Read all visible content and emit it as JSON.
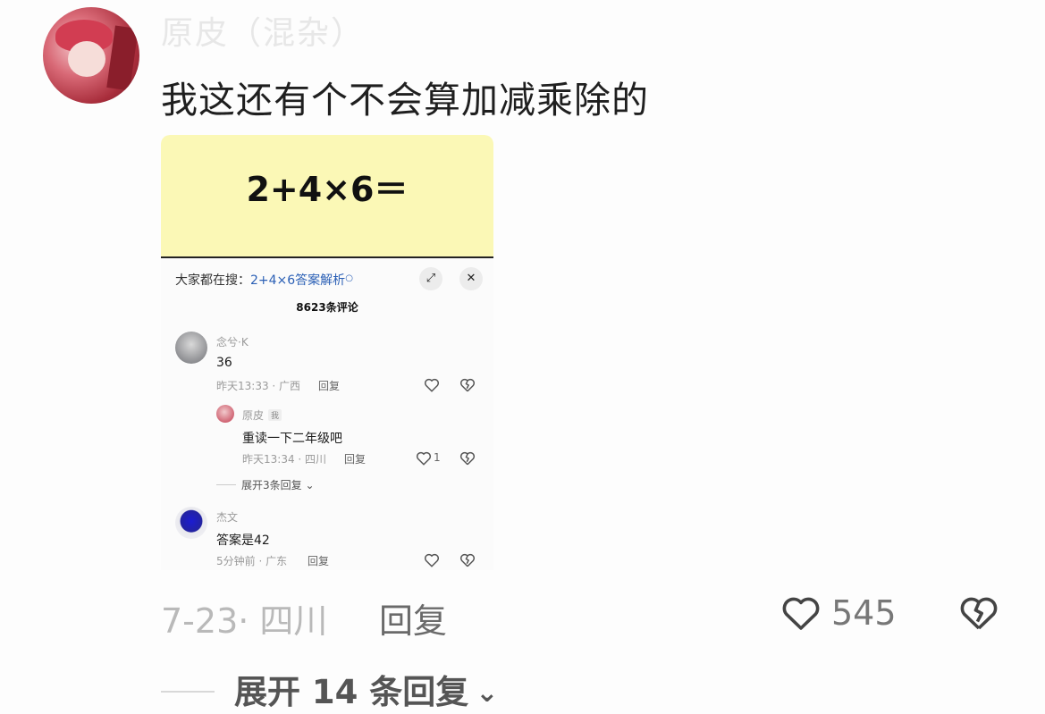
{
  "comment": {
    "username": "原皮（混杂）",
    "text": "我这还有个不会算加减乘除的",
    "meta": "7-23· 四川",
    "reply_label": "回复",
    "like_count": "545",
    "expand_label": "展开 14 条回复",
    "icons": [
      "heart-icon",
      "broken-heart-icon",
      "chevron-down-icon"
    ]
  },
  "embedded": {
    "quiz": "2+4×6＝",
    "search_prefix": "大家都在搜：",
    "search_query": "2+4×6答案解析",
    "comment_count": "8623条评论",
    "comments": [
      {
        "name": "念兮·K",
        "text": "36",
        "time": "昨天13:33 · 广西",
        "reply": "回复"
      },
      {
        "name": "原皮",
        "badge": "我",
        "text": "重读一下二年级吧",
        "time": "昨天13:34 · 四川",
        "reply": "回复",
        "likes": "1"
      },
      {
        "name": "杰文",
        "text": "答案是42",
        "time": "5分钟前 · 广东",
        "reply": "回复"
      }
    ],
    "expand_replies": "展开3条回复"
  }
}
